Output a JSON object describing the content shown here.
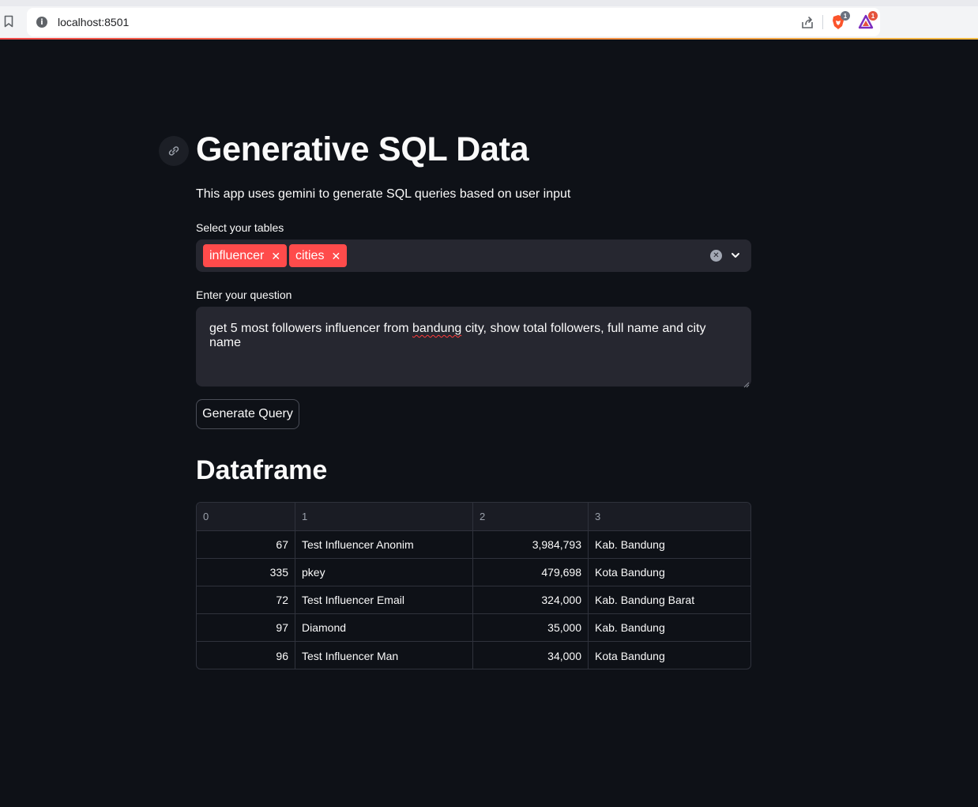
{
  "browser": {
    "url": "localhost:8501",
    "brave_badge": "1",
    "rewards_badge": "1"
  },
  "app": {
    "title": "Generative SQL Data",
    "subtitle": "This app uses gemini to generate SQL queries based on user input"
  },
  "tables_select": {
    "label": "Select your tables",
    "selected": [
      "influencer",
      "cities"
    ]
  },
  "question": {
    "label": "Enter your question",
    "value_before": "get 5 most followers influencer from ",
    "value_misspelled": "bandung",
    "value_after": " city, show total followers, full name and city name"
  },
  "generate_button": {
    "label": "Generate Query"
  },
  "dataframe": {
    "heading": "Dataframe",
    "columns": [
      "0",
      "1",
      "2",
      "3"
    ],
    "rows": [
      [
        "67",
        "Test Influencer Anonim",
        "3,984,793",
        "Kab. Bandung"
      ],
      [
        "335",
        "pkey",
        "479,698",
        "Kota Bandung"
      ],
      [
        "72",
        "Test Influencer Email",
        "324,000",
        "Kab. Bandung Barat"
      ],
      [
        "97",
        "Diamond",
        "35,000",
        "Kab. Bandung"
      ],
      [
        "96",
        "Test Influencer Man",
        "34,000",
        "Kota Bandung"
      ]
    ]
  },
  "colors": {
    "background": "#0e1117",
    "widget": "#262730",
    "accent": "#ff4b4b"
  }
}
